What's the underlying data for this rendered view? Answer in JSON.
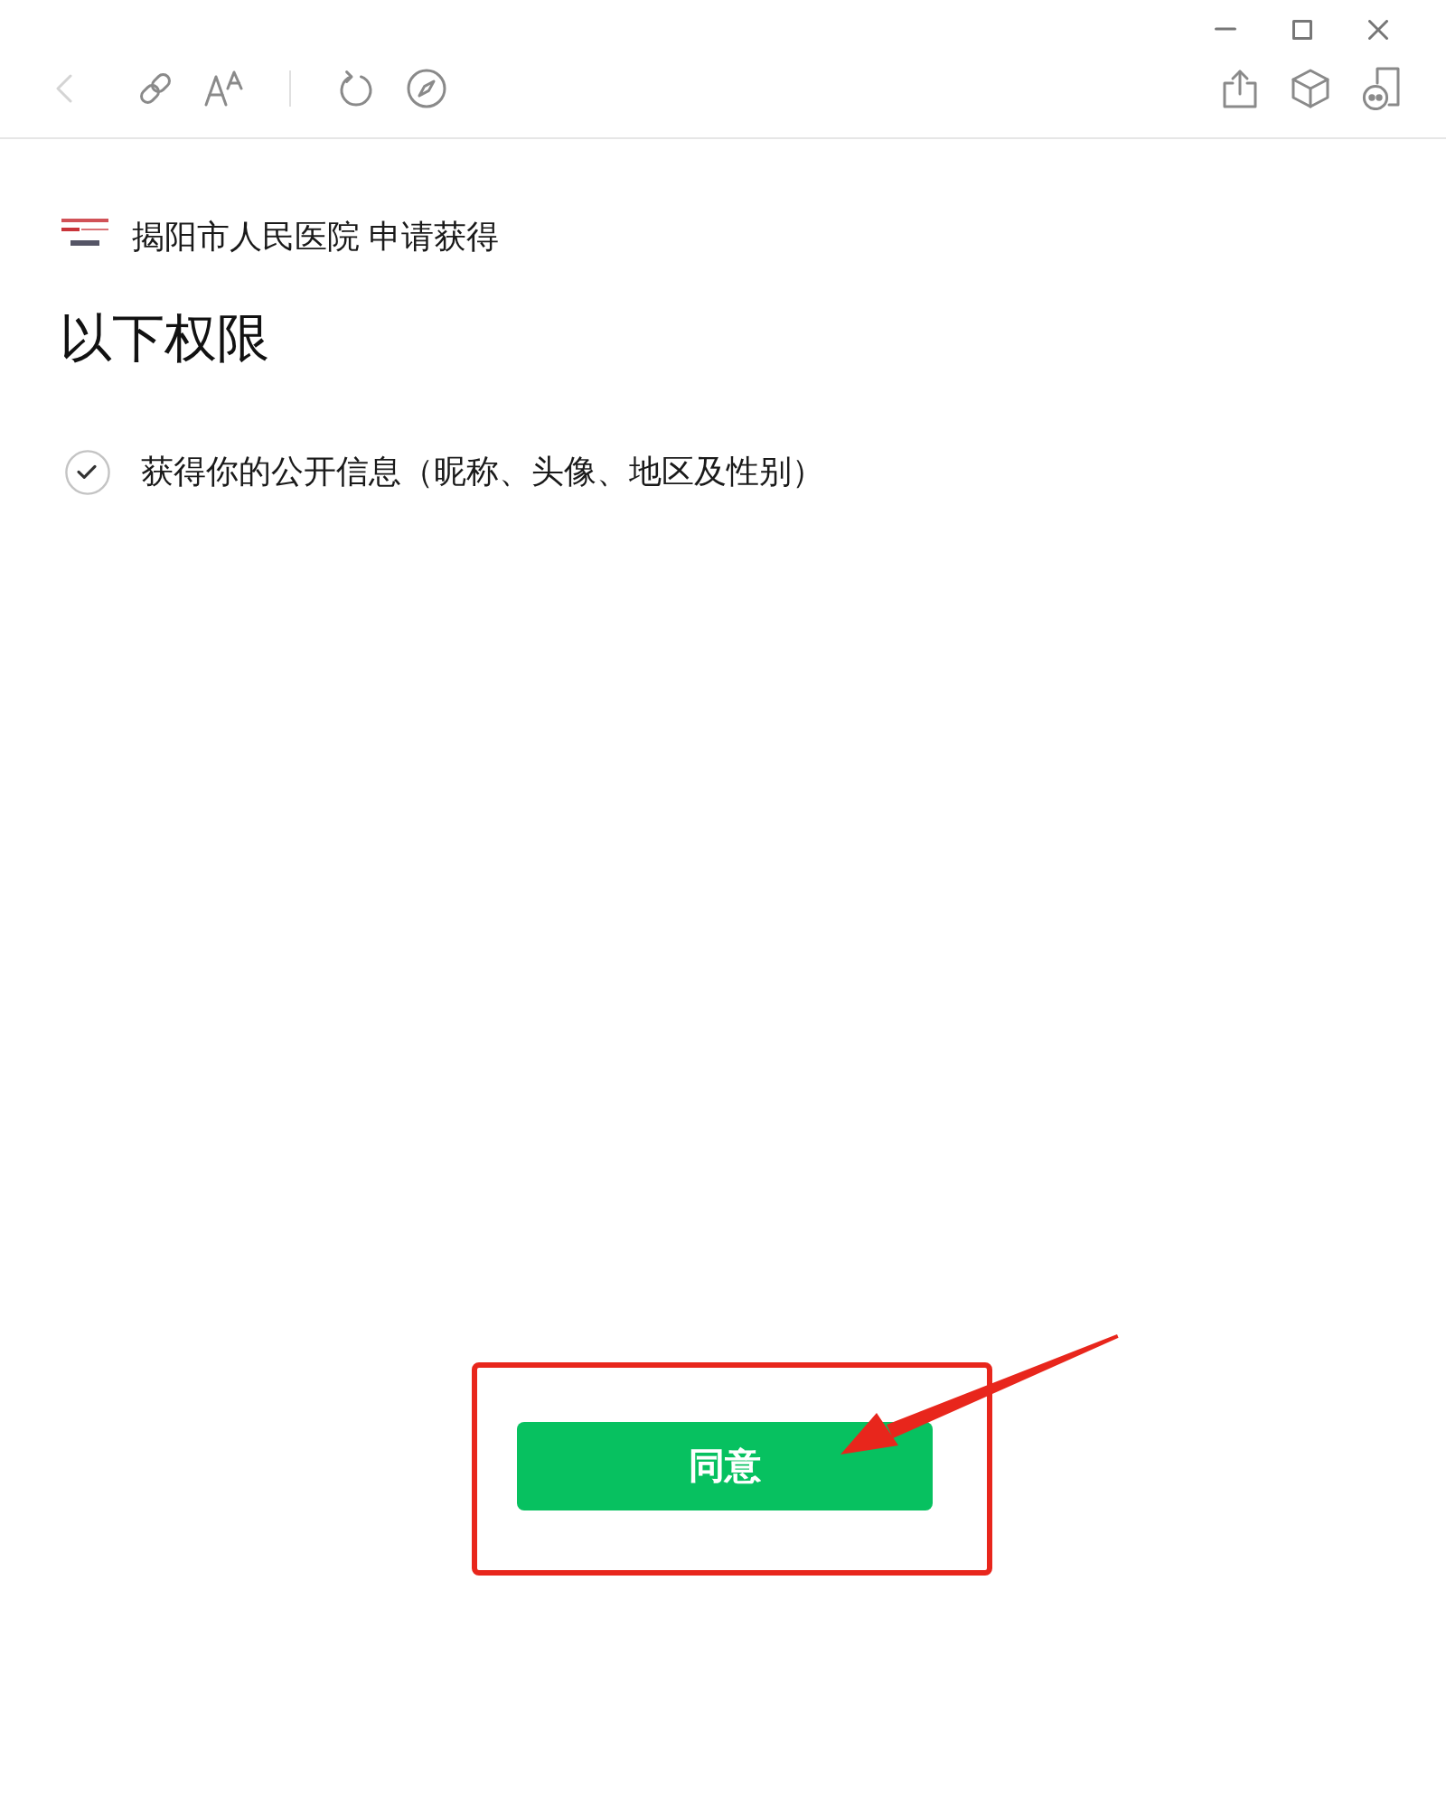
{
  "toolbar": {
    "back": {
      "disabled": true
    }
  },
  "header": {
    "text": "揭阳市人民医院 申请获得"
  },
  "title": "以下权限",
  "permissions": [
    {
      "label": "获得你的公开信息（昵称、头像、地区及性别）",
      "checked": true
    }
  ],
  "buttons": [
    {
      "label": "同意",
      "kind": "primary"
    }
  ],
  "annotations": {
    "highlight_box": true,
    "arrow": true
  }
}
